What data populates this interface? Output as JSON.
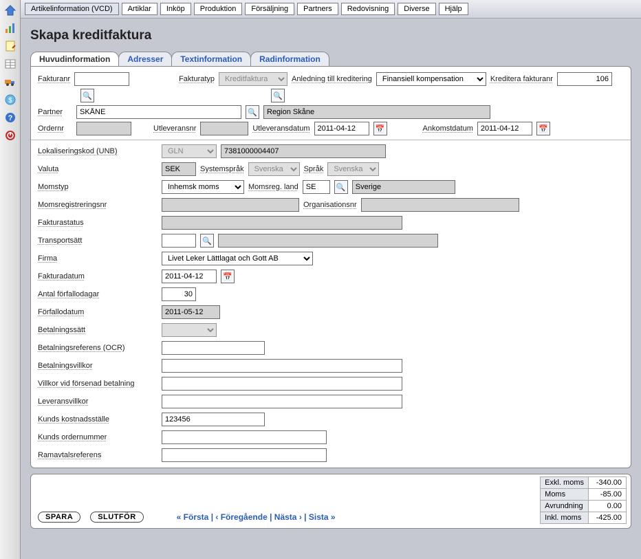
{
  "sidebar_icons": [
    "home",
    "chart",
    "note",
    "table",
    "truck",
    "coin",
    "help",
    "power"
  ],
  "topmenu": [
    {
      "label": "Artikelinformation (VCD)",
      "active": true
    },
    {
      "label": "Artiklar"
    },
    {
      "label": "Inköp"
    },
    {
      "label": "Produktion"
    },
    {
      "label": "Försäljning"
    },
    {
      "label": "Partners"
    },
    {
      "label": "Redovisning"
    },
    {
      "label": "Diverse"
    },
    {
      "label": "Hjälp"
    }
  ],
  "title": "Skapa kreditfaktura",
  "tabs": [
    {
      "label": "Huvudinformation",
      "active": true
    },
    {
      "label": "Adresser"
    },
    {
      "label": "Textinformation"
    },
    {
      "label": "Radinformation"
    }
  ],
  "labels": {
    "fakturanr": "Fakturanr",
    "fakturatyp": "Fakturatyp",
    "anledning": "Anledning till kreditering",
    "kreditera": "Kreditera fakturanr",
    "partner": "Partner",
    "ordernr": "Ordernr",
    "utleveransnr": "Utleveransnr",
    "utleveransdatum": "Utleveransdatum",
    "ankomstdatum": "Ankomstdatum",
    "lokaliseringskod": "Lokaliseringskod (UNB)",
    "valuta": "Valuta",
    "systemsprak": "Systemspråk",
    "sprak": "Språk",
    "momstyp": "Momstyp",
    "momsregland": "Momsreg. land",
    "momsregnr": "Momsregistreringsnr",
    "orgnr": "Organisationsnr",
    "fakturastatus": "Fakturastatus",
    "transportsatt": "Transportsätt",
    "firma": "Firma",
    "fakturadatum": "Fakturadatum",
    "antalforfall": "Antal förfallodagar",
    "forfallodatum": "Förfallodatum",
    "betalningssatt": "Betalningssätt",
    "betalningsref": "Betalningsreferens (OCR)",
    "betalningsvillkor": "Betalningsvillkor",
    "villkorforsenad": "Villkor vid försenad betalning",
    "leveransvillkor": "Leveransvillkor",
    "kundskostnad": "Kunds kostnadsställe",
    "kundsordernummer": "Kunds ordernummer",
    "ramavtal": "Ramavtalsreferens"
  },
  "values": {
    "fakturanr": "",
    "fakturatyp": "Kreditfaktura",
    "anledning": "Finansiell kompensation",
    "kreditera": "106",
    "partner_code": "SKÅNE",
    "partner_name": "Region Skåne",
    "ordernr": "",
    "utleveransnr": "",
    "utleveransdatum": "2011-04-12",
    "ankomstdatum": "2011-04-12",
    "lok_type": "GLN",
    "lok_value": "7381000004407",
    "valuta": "SEK",
    "systemsprak": "Svenska",
    "sprak": "Svenska",
    "momstyp": "Inhemsk moms",
    "momsreg_land_code": "SE",
    "momsreg_land_name": "Sverige",
    "momsregnr": "",
    "orgnr": "",
    "fakturastatus": "",
    "transportsatt_code": "",
    "transportsatt_name": "",
    "firma": "Livet Leker Lättlagat och Gott AB",
    "fakturadatum": "2011-04-12",
    "antalforfall": "30",
    "forfallodatum": "2011-05-12",
    "betalningssatt": "",
    "betalningsref": "",
    "betalningsvillkor": "",
    "villkorforsenad": "",
    "leveransvillkor": "",
    "kundskostnad": "123456",
    "kundsordernummer": "",
    "ramavtal": ""
  },
  "footer": {
    "spara": "SPARA",
    "slutfor": "SLUTFÖR",
    "nav_first": "« Första",
    "nav_prev": "‹ Föregående",
    "nav_next": "Nästa ›",
    "nav_last": "Sista »",
    "sep": " | "
  },
  "totals": {
    "exkl_label": "Exkl. moms",
    "exkl_value": "-340.00",
    "moms_label": "Moms",
    "moms_value": "-85.00",
    "avr_label": "Avrundning",
    "avr_value": "0.00",
    "inkl_label": "Inkl. moms",
    "inkl_value": "-425.00"
  }
}
